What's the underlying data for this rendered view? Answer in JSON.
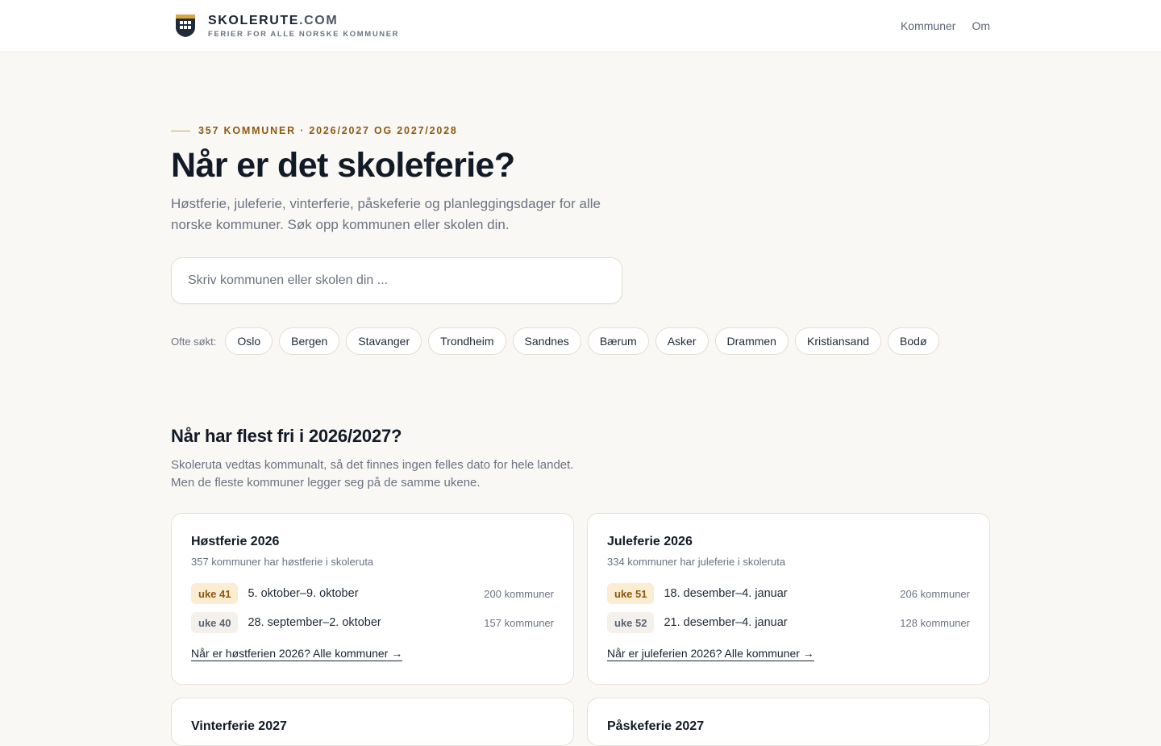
{
  "header": {
    "brand_name": "SKOLERUTE",
    "brand_domain": ".COM",
    "brand_tagline": "FERIER FOR ALLE NORSKE KOMMUNER",
    "nav": [
      {
        "label": "Kommuner"
      },
      {
        "label": "Om"
      }
    ]
  },
  "hero": {
    "eyebrow": "357 KOMMUNER · 2026/2027 OG 2027/2028",
    "title": "Når er det skoleferie?",
    "subtitle": "Høstferie, juleferie, vinterferie, påskeferie og planleggingsdager for alle norske kommuner. Søk opp kommunen eller skolen din.",
    "search_placeholder": "Skriv kommunen eller skolen din ...",
    "popular_label": "Ofte søkt:",
    "popular": [
      "Oslo",
      "Bergen",
      "Stavanger",
      "Trondheim",
      "Sandnes",
      "Bærum",
      "Asker",
      "Drammen",
      "Kristiansand",
      "Bodø"
    ]
  },
  "section": {
    "title": "Når har flest fri i 2026/2027?",
    "desc_line1": "Skoleruta vedtas kommunalt, så det finnes ingen felles dato for hele landet.",
    "desc_line2": "Men de fleste kommuner legger seg på de samme ukene.",
    "cards": [
      {
        "title": "Høstferie 2026",
        "sub": "357 kommuner har høstferie i skoleruta",
        "periods": [
          {
            "week": "uke 41",
            "dates": "5. oktober–9. oktober",
            "count": "200 kommuner"
          },
          {
            "week": "uke 40",
            "dates": "28. september–2. oktober",
            "count": "157 kommuner"
          }
        ],
        "link": "Når er høstferien 2026? Alle kommuner →"
      },
      {
        "title": "Juleferie 2026",
        "sub": "334 kommuner har juleferie i skoleruta",
        "periods": [
          {
            "week": "uke 51",
            "dates": "18. desember–4. januar",
            "count": "206 kommuner"
          },
          {
            "week": "uke 52",
            "dates": "21. desember–4. januar",
            "count": "128 kommuner"
          }
        ],
        "link": "Når er juleferien 2026? Alle kommuner →"
      },
      {
        "title": "Vinterferie 2027"
      },
      {
        "title": "Påskeferie 2027"
      }
    ]
  },
  "colors": {
    "background": "#faf8f5",
    "accent": "#8a5a12",
    "week_primary_bg": "#fbecd2",
    "logo_shield": "#1f2b3a",
    "logo_gold": "#d9a63a"
  },
  "icons": {
    "logo": "school-shield-icon"
  }
}
